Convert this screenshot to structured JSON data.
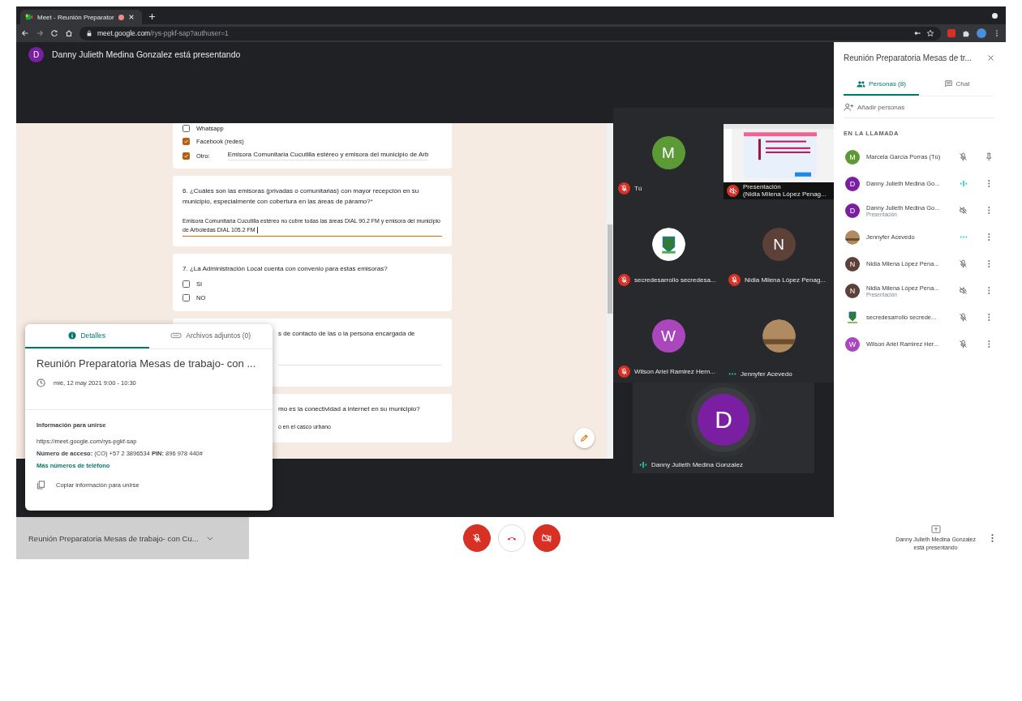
{
  "browser": {
    "tab_title": "Meet - Reunión Preparator",
    "url_host": "meet.google.com",
    "url_path": "/rys-pgkf-sap?authuser=1"
  },
  "presenter_banner": {
    "letter": "D",
    "text": "Danny Julieth Medina Gonzalez está presentando"
  },
  "form": {
    "options": [
      {
        "label": "Whatsapp",
        "checked": false
      },
      {
        "label": "Facebook (redes)",
        "checked": true
      },
      {
        "label": "Otro:",
        "checked": true,
        "value": "Emisora Comunitaria Cucutilla estéreo y emisora del municipio de Arb"
      }
    ],
    "questions": [
      {
        "kind": "text",
        "title": "6. ¿Cuáles son las emisoras (privadas o comunitarias) con mayor recepción en su municipio, especialmente con cobertura en las áreas de páramo?",
        "required_mark": "*",
        "answer": "Emisora Comunitaria Cucutilla estéreo no cubre todas las áreas DIAL 90.2 FM  y emisora del municipio de Arboledas DIAL 105.2 FM"
      },
      {
        "kind": "checkboxes",
        "title": "7. ¿La Administración Local cuenta con convenio para estas emisoras?",
        "options": [
          {
            "label": "SI",
            "checked": false
          },
          {
            "label": "NO",
            "checked": false
          }
        ]
      },
      {
        "kind": "partial",
        "title": "s de contacto de las o la persona encargada de"
      },
      {
        "kind": "partial",
        "title": "mo es la conectividad a internet en su municipio?",
        "answer": "o en el casco urbano"
      }
    ]
  },
  "tiles": [
    {
      "kind": "avatar",
      "letter": "M",
      "color": "#5c9a35",
      "name": "Tú",
      "audio": {
        "kind": "muted"
      }
    },
    {
      "kind": "presentation",
      "name": "Presentación",
      "subname": "(Nidia Milena López Penag...",
      "audio": {
        "kind": "presenting-muted"
      }
    },
    {
      "kind": "logo",
      "name": "secredesarrollo secredesa...",
      "audio": {
        "kind": "muted"
      }
    },
    {
      "kind": "avatar",
      "letter": "N",
      "color": "#5d4037",
      "name": "Nidia Milena López Penag...",
      "audio": {
        "kind": "muted"
      }
    },
    {
      "kind": "avatar",
      "letter": "W",
      "color": "#ab47bc",
      "name": "Wilson Ariel Ramirez Hern...",
      "audio": {
        "kind": "muted"
      }
    },
    {
      "kind": "photo",
      "name": "Jennyfer Acevedo",
      "audio": {
        "kind": "idle"
      }
    }
  ],
  "main_tile": {
    "letter": "D",
    "color": "#7b1fa2",
    "name": "Danny Julieth Medina Gonzalez",
    "audio": {
      "kind": "speaking"
    }
  },
  "panel": {
    "title": "Reunión Preparatoria Mesas de tr...",
    "tabs": [
      {
        "kind": "people",
        "label": "Personas (8)",
        "selected": true
      },
      {
        "kind": "chat",
        "label": "Chat",
        "selected": false
      }
    ],
    "add_people": "Añadir personas",
    "section": "EN LA LLAMADA",
    "people": [
      {
        "avatar": {
          "kind": "letter",
          "letter": "M",
          "color": "#5c9a35"
        },
        "name": "Marcela García Porras (Tú)",
        "audio": {
          "kind": "muted"
        },
        "action": {
          "kind": "pin"
        }
      },
      {
        "avatar": {
          "kind": "letter",
          "letter": "D",
          "color": "#7b1fa2"
        },
        "name": "Danny Julieth Medina Go...",
        "audio": {
          "kind": "speaking"
        },
        "action": {
          "kind": "more"
        }
      },
      {
        "avatar": {
          "kind": "letter",
          "letter": "D",
          "color": "#7b1fa2"
        },
        "name": "Danny Julieth Medina Go...",
        "subtitle": "Presentación",
        "audio": {
          "kind": "presenting-muted"
        },
        "action": {
          "kind": "more"
        }
      },
      {
        "avatar": {
          "kind": "photo"
        },
        "name": "Jennyfer Acevedo",
        "audio": {
          "kind": "idle"
        },
        "action": {
          "kind": "more"
        }
      },
      {
        "avatar": {
          "kind": "letter",
          "letter": "N",
          "color": "#5d4037"
        },
        "name": "Nidia Milena López Pena...",
        "audio": {
          "kind": "muted"
        },
        "action": {
          "kind": "more"
        }
      },
      {
        "avatar": {
          "kind": "letter",
          "letter": "N",
          "color": "#5d4037"
        },
        "name": "Nidia Milena López Pena...",
        "subtitle": "Presentación",
        "audio": {
          "kind": "presenting-muted"
        },
        "action": {
          "kind": "more"
        }
      },
      {
        "avatar": {
          "kind": "logo"
        },
        "name": "secredesarrollo secrede...",
        "audio": {
          "kind": "muted"
        },
        "action": {
          "kind": "more"
        }
      },
      {
        "avatar": {
          "kind": "letter",
          "letter": "W",
          "color": "#ab47bc"
        },
        "name": "Wilson Ariel Ramirez Her...",
        "audio": {
          "kind": "muted"
        },
        "action": {
          "kind": "more"
        }
      }
    ]
  },
  "details": {
    "tabs": [
      {
        "kind": "info",
        "label": "Detalles",
        "selected": true
      },
      {
        "kind": "attach",
        "label": "Archivos adjuntos (0)",
        "selected": false
      }
    ],
    "title": "Reunión Preparatoria Mesas de trabajo- con ...",
    "date": "mié, 12 may 2021 9:00 - 10:30",
    "join_heading": "Información para unirse",
    "link": "https://meet.google.com/rys-pgkf-sap",
    "access": "**Número de acceso:** (CO) +57 2 3896534  **PIN:** 896 978 440#",
    "more_numbers": "Más números de teléfono",
    "copy": "Copiar información para unirse"
  },
  "bottom_bar": {
    "meeting_title": "Reunión Preparatoria Mesas de trabajo- con Cu...",
    "controls": [
      {
        "kind": "mic",
        "on": false
      },
      {
        "kind": "hangup"
      },
      {
        "kind": "camera",
        "on": false
      }
    ],
    "presenter_name": "Danny Julieth Medina Gonzalez",
    "presenter_status": "está presentando"
  }
}
